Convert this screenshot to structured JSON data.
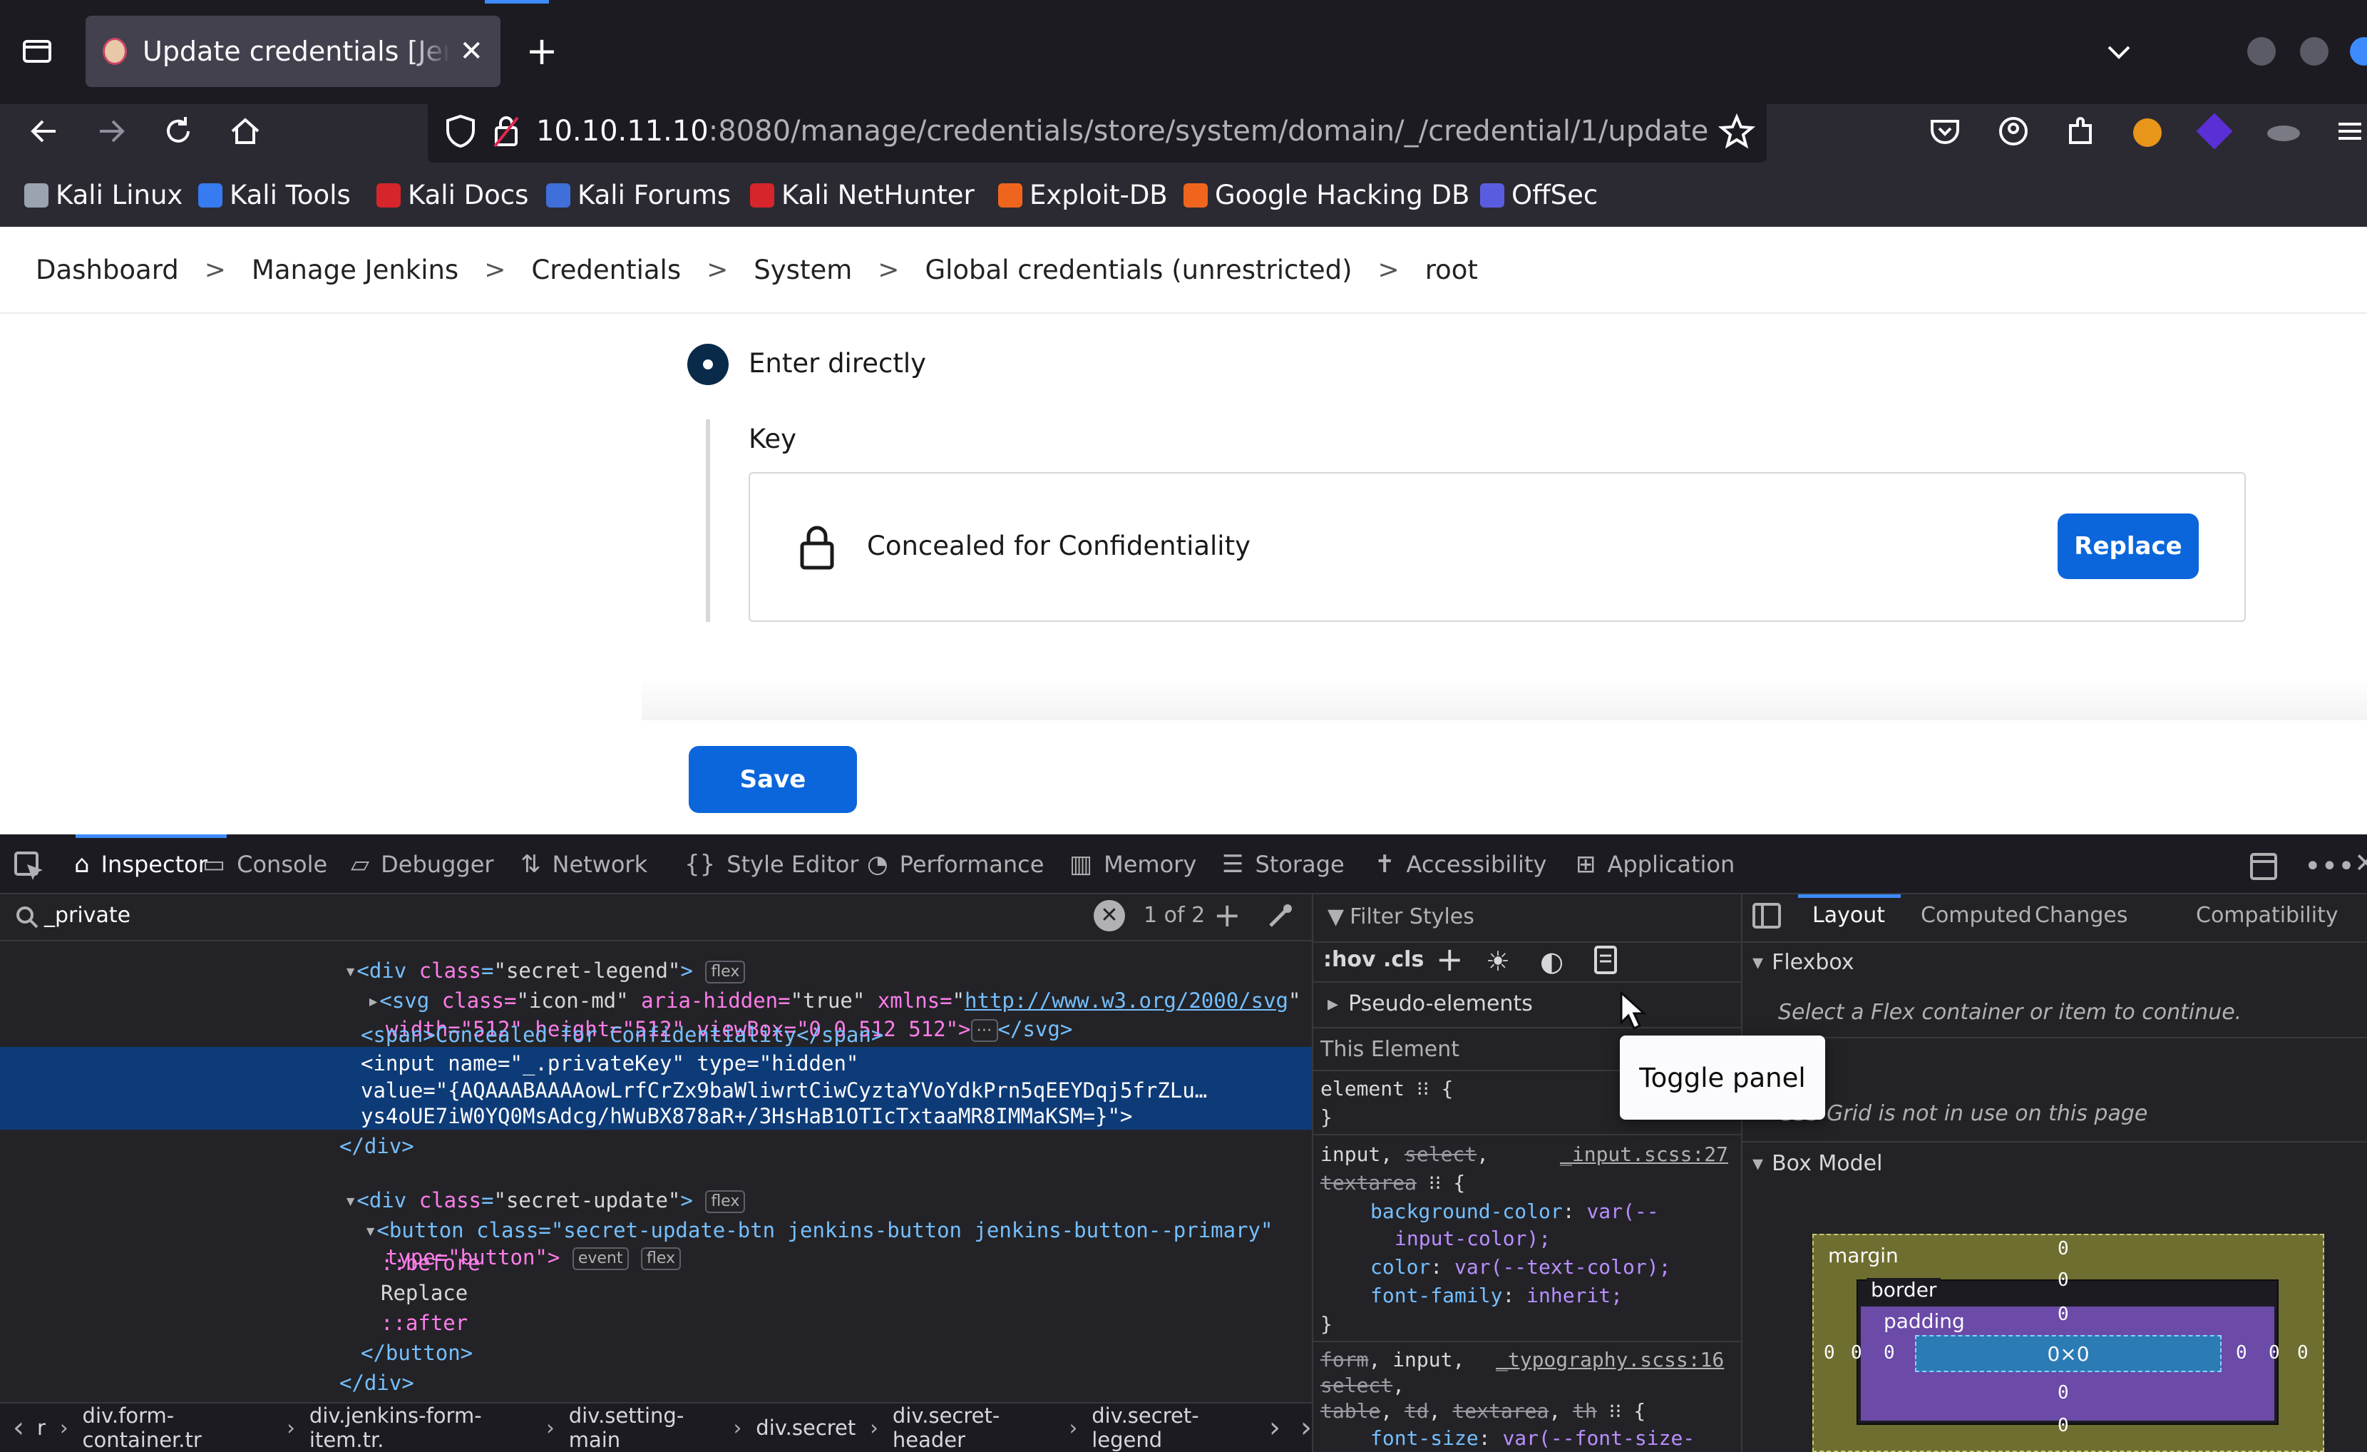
{
  "browser": {
    "tab_title": "Update credentials [Jenkins]",
    "url_host": "10.10.11.10",
    "url_rest": ":8080/manage/credentials/store/system/domain/_/credential/1/update",
    "bookmarks": [
      {
        "label": "Kali Linux",
        "color": "#9aa4b0"
      },
      {
        "label": "Kali Tools",
        "color": "#367bf0"
      },
      {
        "label": "Kali Docs",
        "color": "#d6252b"
      },
      {
        "label": "Kali Forums",
        "color": "#3f6fd8"
      },
      {
        "label": "Kali NetHunter",
        "color": "#d6252b"
      },
      {
        "label": "Exploit-DB",
        "color": "#f0651d"
      },
      {
        "label": "Google Hacking DB",
        "color": "#f0651d"
      },
      {
        "label": "OffSec",
        "color": "#5a5ce0"
      }
    ]
  },
  "breadcrumb": [
    "Dashboard",
    "Manage Jenkins",
    "Credentials",
    "System",
    "Global credentials (unrestricted)",
    "root"
  ],
  "breadcrumb_sep": ">",
  "form": {
    "radio_label": "Enter directly",
    "key_label": "Key",
    "concealed_text": "Concealed for Confidentiality",
    "replace_label": "Replace",
    "save_label": "Save"
  },
  "devtools": {
    "tabs": [
      "Inspector",
      "Console",
      "Debugger",
      "Network",
      "Style Editor",
      "Performance",
      "Memory",
      "Storage",
      "Accessibility",
      "Application"
    ],
    "active_tab": "Inspector",
    "search_value": "_private",
    "match_count": "1 of 2",
    "html_lines": {
      "l1_tag": "<div ",
      "l1_an": "class",
      "l1_av": "\"secret-legend\"",
      "l1_badge": "flex",
      "l2_a": "<svg ",
      "l2_b": "class=",
      "l2_c": "\"icon-md\" ",
      "l2_d": "aria-hidden=",
      "l2_e": "\"true\" ",
      "l2_f": "xmlns=",
      "l2_g": "\"",
      "l2_link": "http://www.w3.org/2000/svg",
      "l2_h": "\"",
      "l3": "width=\"512\" height=\"512\" viewBox=\"0 0 512 512\">",
      "l3_end": "</svg>",
      "l4": "<span>Concealed for Confidentiality</span>",
      "l5": "<input name=\"_.privateKey\" type=\"hidden\"",
      "l6": "value=\"{AQAAABAAAAowLrfCrZx9baWliwrtCiwCyztaYVoYdkPrn5qEEYDqj5frZLu…",
      "l7": "ys4oUE7iW0YQ0MsAdcg/hWuBX878aR+/3HsHaB1OTIcTxtaaMR8IMMaKSM=}\">",
      "l8": "</div>",
      "l9_tag": "<div ",
      "l9_an": "class",
      "l9_av": "\"secret-update\"",
      "l9_badge": "flex",
      "l10": "<button class=\"secret-update-btn jenkins-button jenkins-button--primary\"",
      "l11": "type=\"button\">",
      "l11_b1": "event",
      "l11_b2": "flex",
      "l12": "::before",
      "l13": "Replace",
      "l14": "::after",
      "l15": "</button>",
      "l16": "</div>"
    },
    "dom_breadcrumb": [
      "r",
      "div.form-container.tr",
      "div.jenkins-form-item.tr.",
      "div.setting-main",
      "div.secret",
      "div.secret-header",
      "div.secret-legend"
    ],
    "rules": {
      "filter_placeholder": "Filter Styles",
      "hov": ":hov",
      "cls": ".cls",
      "pseudo": "Pseudo-elements",
      "this_element": "This Element",
      "element_rule": "element",
      "r1_sel_a": "input, ",
      "r1_sel_b": "select",
      "r1_sel_c": ",",
      "r1_sel_d": "textarea",
      "r1_src": "_input.scss:27",
      "r1_p1": "background-color",
      "r1_v1a": "var(--",
      "r1_v1b": "input-color);",
      "r1_p2": "color",
      "r1_v2": "var(--text-color);",
      "r1_p3": "font-family",
      "r1_v3": "inherit;",
      "r2_sel_a": "form",
      "r2_sel_b": ", input,",
      "r2_src": "_typography.scss:16",
      "r2_sel_c": "select",
      "r2_sel_d": "table",
      "r2_sel_e": "td",
      "r2_sel_f": "textarea",
      "r2_sel_g": "th",
      "r2_p1": "font-size",
      "r2_v1": "var(--font-size-"
    },
    "layout": {
      "tabs": [
        "Layout",
        "Computed",
        "Changes",
        "Compatibility"
      ],
      "flexbox_title": "Flexbox",
      "flexbox_msg": "Select a Flex container or item to continue.",
      "grid_msg": "CSS Grid is not in use on this page",
      "boxmodel_title": "Box Model",
      "margin": "margin",
      "border": "border",
      "padding": "padding",
      "content": "0×0",
      "zero": "0"
    },
    "tooltip": "Toggle panel"
  }
}
